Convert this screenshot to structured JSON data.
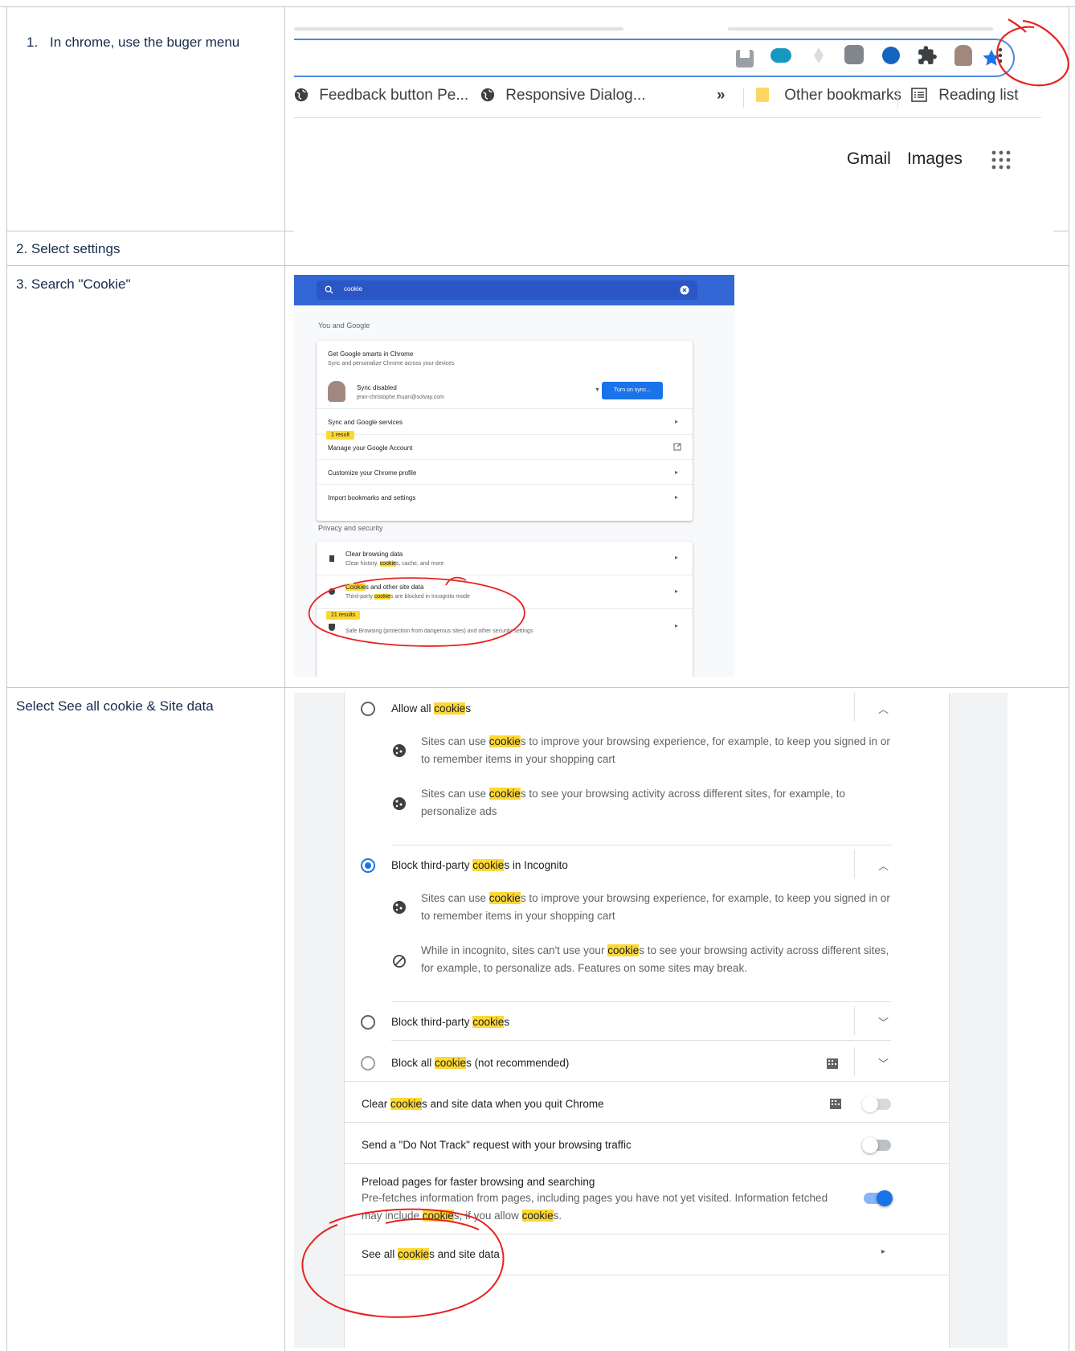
{
  "steps": {
    "s1": "In chrome, use the buger menu",
    "s1_num": "1.",
    "s2": "2. Select settings",
    "s3": "3. Search \"Cookie\"",
    "s4": "Select See all cookie & Site data"
  },
  "toolbar": {
    "bookmark1": "Feedback button Pe...",
    "bookmark2": "Responsive Dialog...",
    "more": "»",
    "other_bookmarks": "Other bookmarks",
    "reading_list": "Reading list",
    "gmail": "Gmail",
    "images": "Images"
  },
  "settings_search": {
    "query": "cookie",
    "you_and_google": "You and Google",
    "smarts_title": "Get Google smarts in Chrome",
    "smarts_sub": "Sync and personalize Chrome across your devices",
    "sync_status": "Sync disabled",
    "sync_email": "jean-christophe.thuan@solvay.com",
    "turn_on_sync": "Turn on sync...",
    "sync_services": "Sync and Google services",
    "one_result": "1 result",
    "manage_account": "Manage your Google Account",
    "customize_profile": "Customize your Chrome profile",
    "import_bookmarks": "Import bookmarks and settings",
    "privacy": "Privacy and security",
    "clear_title": "Clear browsing data",
    "clear_sub_a": "Clear history, ",
    "clear_sub_hl": "cookie",
    "clear_sub_b": "s, cache, and more",
    "cookies_title_hl": "Cookie",
    "cookies_title_b": "s and other site data",
    "cookies_sub_a": "Third-party ",
    "cookies_sub_hl": "cookie",
    "cookies_sub_b": "s are blocked in Incognito mode",
    "results_tip": "21 results",
    "security_sub": "Safe Browsing (protection from dangerous sites) and other security settings"
  },
  "cookie_settings": {
    "allow_all_a": "Allow all ",
    "hl": "cookie",
    "allow_all_b": "s",
    "allow_desc1_a": "Sites can use ",
    "allow_desc1_b": "s to improve your browsing experience, for example, to keep you signed in or",
    "allow_desc1_c": "to remember items in your shopping cart",
    "allow_desc2_a": "Sites can use ",
    "allow_desc2_b": "s to see your browsing activity across different sites, for example, to",
    "allow_desc2_c": "personalize ads",
    "block_incog_a": "Block third-party ",
    "block_incog_b": "s in Incognito",
    "incog_desc1_a": "Sites can use ",
    "incog_desc1_b": "s to improve your browsing experience, for example, to keep you signed in or",
    "incog_desc1_c": "to remember items in your shopping cart",
    "incog_desc2_a": "While in incognito, sites can't use your ",
    "incog_desc2_b": "s to see your browsing activity across different sites,",
    "incog_desc2_c": "for example, to personalize ads. Features on some sites may break.",
    "block_third_a": "Block third-party ",
    "block_third_b": "s",
    "block_all_a": "Block all ",
    "block_all_b": "s (not recommended)",
    "clear_quit_a": "Clear ",
    "clear_quit_b": "s and site data when you quit Chrome",
    "dnt": "Send a \"Do Not Track\" request with your browsing traffic",
    "preload_title": "Preload pages for faster browsing and searching",
    "preload_desc_a": "Pre-fetches information from pages, including pages you have not yet visited. Information fetched",
    "preload_desc_b": "may include ",
    "preload_desc_c": "s, if you allow ",
    "preload_desc_d": "s.",
    "see_all_a": "See all ",
    "see_all_b": "s and site data",
    "toggle_clear_quit": false,
    "toggle_dnt": false,
    "toggle_preload": true
  },
  "colors": {
    "highlight": "#fdd835",
    "annotation": "#e8221f",
    "chrome_blue": "#1a73e8"
  }
}
